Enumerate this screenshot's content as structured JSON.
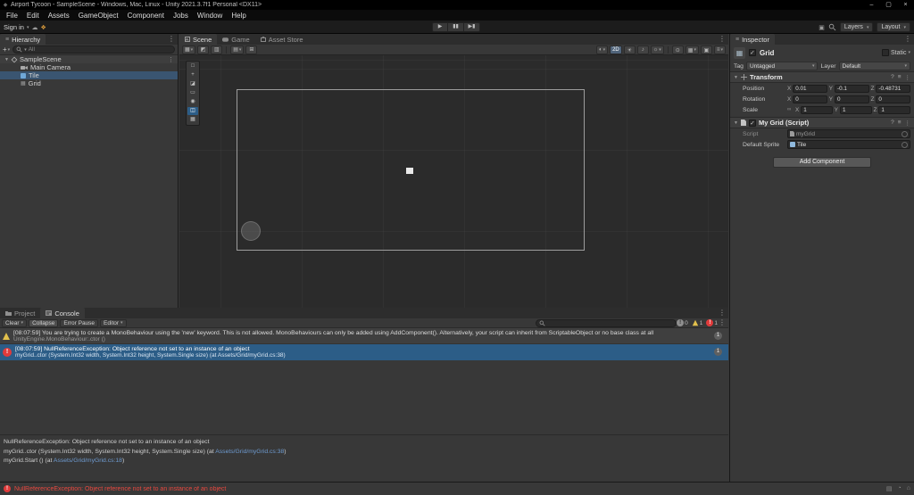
{
  "colors": {
    "selection_blue": "#2c5d87",
    "hierarchy_selection": "#3a5571",
    "warning_yellow": "#e2c04c",
    "error_red": "#e13b3b",
    "link_blue": "#6e9bd1",
    "status_error_text": "#e8483f",
    "panel_bg": "#383838",
    "canvas_bg": "#2b2b2b"
  },
  "icons": {
    "unity_logo": "◆",
    "minimize": "–",
    "maximize": "▢",
    "close": "×",
    "dropdown_arrow": "▾",
    "foldout": "▼",
    "menu_dots": "⋮",
    "hamburger": "≡",
    "play": "▶",
    "pause": "▮▮",
    "step": "▶▮",
    "plus": "+",
    "help": "?",
    "presets": "≡",
    "link": "∞",
    "picker_dot": "●",
    "grid_glyph": "▦",
    "cloud": "☁",
    "collab": "❖",
    "shaded": "◐",
    "light": "☀",
    "audio": "♪",
    "effects": "☼",
    "eye": "⊙",
    "gizmos": "▣",
    "exclaim": "!",
    "info_i": "i",
    "check": "✓",
    "palette": [
      "□",
      "+",
      "◪",
      "▭",
      "◉",
      "◫",
      "▦"
    ],
    "scene_left_tools": [
      "▦",
      "◩",
      "▥",
      "▤",
      "⊞"
    ],
    "status_icons": [
      "▤",
      "◔",
      "⌂"
    ]
  },
  "title_bar": {
    "title": "Airport Tycoon - SampleScene - Windows, Mac, Linux - Unity 2021.3.7f1 Personal <DX11>"
  },
  "menu_bar": {
    "items": [
      "File",
      "Edit",
      "Assets",
      "GameObject",
      "Component",
      "Jobs",
      "Window",
      "Help"
    ]
  },
  "toolbar": {
    "sign_in_label": "Sign in",
    "layers_label": "Layers",
    "layout_label": "Layout"
  },
  "hierarchy": {
    "tab_label": "Hierarchy",
    "search_filter": "All",
    "scene_row": {
      "label": "SampleScene"
    },
    "items": [
      {
        "label": "Main Camera"
      },
      {
        "label": "Tile"
      },
      {
        "label": "Grid"
      }
    ]
  },
  "scene_view": {
    "tabs": [
      {
        "label": "Scene"
      },
      {
        "label": "Game"
      },
      {
        "label": "Asset Store"
      }
    ],
    "mode_2d_label": "2D"
  },
  "inspector": {
    "tab_label": "Inspector",
    "header": {
      "name": "Grid",
      "static_label": "Static"
    },
    "tag_label": "Tag",
    "tag_value": "Untagged",
    "layer_label": "Layer",
    "layer_value": "Default",
    "transform": {
      "title": "Transform",
      "axis_x": "X",
      "axis_y": "Y",
      "axis_z": "Z",
      "rows": [
        {
          "label": "Position",
          "x": "0.01",
          "y": "-0.1",
          "z": "-0.48731"
        },
        {
          "label": "Rotation",
          "x": "0",
          "y": "0",
          "z": "0"
        },
        {
          "label": "Scale",
          "x": "1",
          "y": "1",
          "z": "1"
        }
      ]
    },
    "my_grid": {
      "title": "My Grid (Script)",
      "script_label": "Script",
      "script_value": "myGrid",
      "sprite_label": "Default Sprite",
      "sprite_value": "Tile"
    },
    "add_component_label": "Add Component"
  },
  "console": {
    "project_tab": "Project",
    "console_tab": "Console",
    "toolbar": {
      "clear": "Clear",
      "collapse": "Collapse",
      "error_pause": "Error Pause",
      "editor": "Editor"
    },
    "counts": {
      "info": "0",
      "warning": "1",
      "error": "1"
    },
    "messages": [
      {
        "type": "warning",
        "line1": "[08:07:59] You are trying to create a MonoBehaviour using the 'new' keyword.  This is not allowed.  MonoBehaviours can only be added using AddComponent(). Alternatively, your script can inherit from ScriptableObject or no base class at all",
        "line2": "UnityEngine.MonoBehaviour:.ctor ()",
        "badge": "1"
      },
      {
        "type": "error",
        "selected": true,
        "line1": "[08:07:59] NullReferenceException: Object reference not set to an instance of an object",
        "line2": "myGrid..ctor (System.Int32 width, System.Int32 height, System.Single size) (at Assets/Grid/myGrid.cs:38)",
        "badge": "1"
      }
    ],
    "detail": {
      "line1": "NullReferenceException: Object reference not set to an instance of an object",
      "line2_prefix": "myGrid..ctor (System.Int32 width, System.Int32 height, System.Single size) (at ",
      "line2_link": "Assets/Grid/myGrid.cs:38",
      "line2_suffix": ")",
      "line3_prefix": "myGrid.Start () (at ",
      "line3_link": "Assets/Grid/myGrid.cs:18",
      "line3_suffix": ")"
    }
  },
  "status_bar": {
    "error_text": "NullReferenceException: Object reference not set to an instance of an object"
  }
}
